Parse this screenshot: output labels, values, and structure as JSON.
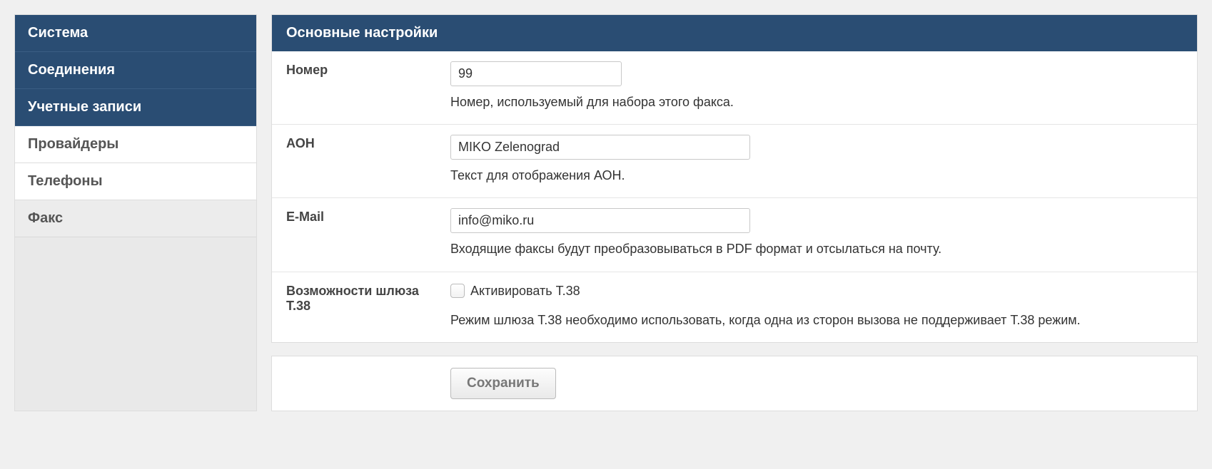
{
  "sidebar": {
    "items": [
      {
        "label": "Система",
        "style": "dark"
      },
      {
        "label": "Соединения",
        "style": "dark"
      },
      {
        "label": "Учетные записи",
        "style": "dark"
      },
      {
        "label": "Провайдеры",
        "style": "light"
      },
      {
        "label": "Телефоны",
        "style": "light"
      },
      {
        "label": "Факс",
        "style": "active"
      }
    ]
  },
  "panel": {
    "title": "Основные настройки",
    "number": {
      "label": "Номер",
      "value": "99",
      "help": "Номер, используемый для набора этого факса."
    },
    "aon": {
      "label": "АОН",
      "value": "MIKO Zelenograd",
      "help": "Текст для отображения АОН."
    },
    "email": {
      "label": "E-Mail",
      "value": "info@miko.ru",
      "help": "Входящие факсы будут преобразовываться в PDF формат и отсылаться на почту."
    },
    "t38": {
      "label": "Возможности шлюза T.38",
      "checkbox_label": "Активировать T.38",
      "help": "Режим шлюза T.38 необходимо использовать, когда одна из сторон вызова не поддерживает T.38 режим."
    },
    "save_label": "Сохранить"
  }
}
